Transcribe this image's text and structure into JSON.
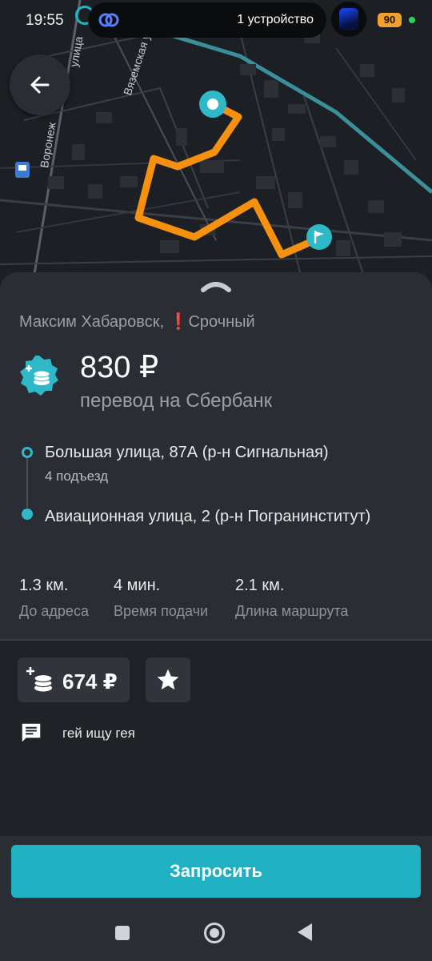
{
  "status_bar": {
    "time": "19:55",
    "devices_text": "1 устройство",
    "battery": "90"
  },
  "map": {
    "street_labels": [
      "Вяземская улица",
      "Воронеж",
      "улица"
    ],
    "route_color": "#f5910f",
    "marker_color": "#2fb8c8"
  },
  "order": {
    "client": "Максим Хабаровск,",
    "urgent_mark": "❗",
    "urgent_label": "Срочный",
    "price": "830 ₽",
    "payment_method": "перевод на Сбербанк",
    "pickup_address": "Большая улица, 87А (р-н Сигнальная)",
    "pickup_detail": "4 подъезд",
    "dropoff_address": "Авиационная улица, 2 (р-н Погранинститут)",
    "stats": [
      {
        "value": "1.3 км.",
        "label": "До адреса"
      },
      {
        "value": "4 мин.",
        "label": "Время подачи"
      },
      {
        "value": "2.1 км.",
        "label": "Длина маршрута"
      }
    ],
    "bonus_amount": "674 ₽",
    "comment": "гей ищу гея"
  },
  "actions": {
    "request_label": "Запросить"
  },
  "colors": {
    "accent": "#1fb0c1",
    "route": "#f5910f",
    "urgent": "#e0322f"
  }
}
